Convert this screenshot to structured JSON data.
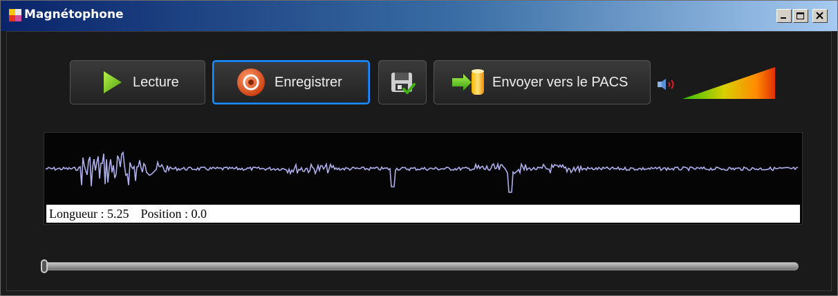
{
  "window": {
    "title": "Magnétophone"
  },
  "toolbar": {
    "play_label": "Lecture",
    "record_label": "Enregistrer",
    "send_label": "Envoyer vers le PACS"
  },
  "volume": {
    "level": 1.0
  },
  "status": {
    "length_label": "Longueur :",
    "length_value": "5.25",
    "position_label": "Position :",
    "position_value": "0.0"
  },
  "seek": {
    "position_fraction": 0.0
  },
  "colors": {
    "waveform": "#b0b0f0",
    "accent_focus": "#1e90ff",
    "play_green": "#7fd11b",
    "record_orange": "#f05a1e"
  }
}
